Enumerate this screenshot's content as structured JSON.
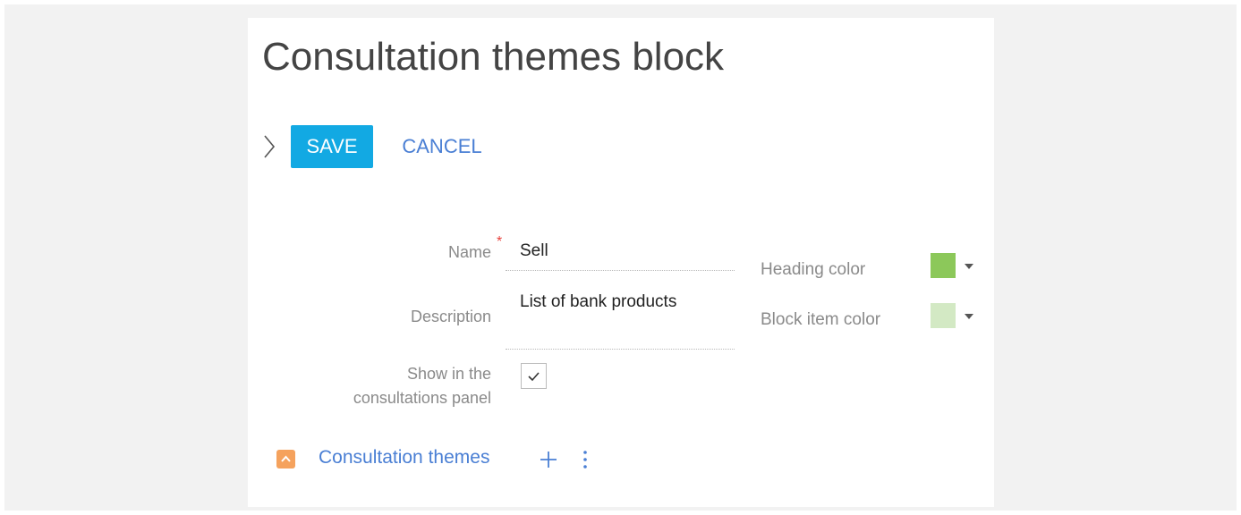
{
  "page": {
    "title": "Consultation themes block"
  },
  "toolbar": {
    "save_label": "SAVE",
    "cancel_label": "CANCEL"
  },
  "form": {
    "name": {
      "label": "Name",
      "required_mark": "*",
      "value": "Sell"
    },
    "description": {
      "label": "Description",
      "value": "List of bank products"
    },
    "show_in_panel": {
      "label_line1": "Show in the",
      "label_line2": "consultations panel",
      "checked": true
    },
    "heading_color": {
      "label": "Heading color",
      "color": "#8cc85a"
    },
    "block_item_color": {
      "label": "Block item color",
      "color": "#d3e9c4"
    }
  },
  "detail": {
    "title": "Consultation themes",
    "toggle_icon": "chevron-up-icon",
    "add_icon": "plus-icon",
    "menu_icon": "vertical-dots-icon"
  },
  "colors": {
    "accent": "#12a9e3",
    "link": "#4a7fd4",
    "required": "#e8413c",
    "detail_toggle": "#f5a25d"
  }
}
